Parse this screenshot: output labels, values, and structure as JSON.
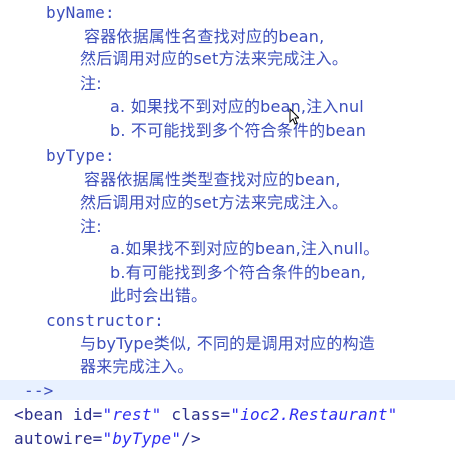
{
  "doc": {
    "byName": {
      "heading": "byName:",
      "desc1": "容器依据属性名查找对应的bean,",
      "desc2": "然后调用对应的set方法来完成注入。",
      "note": "注:",
      "a": "a. 如果找不到对应的bean,注入nul",
      "b": "b. 不可能找到多个符合条件的bean"
    },
    "byType": {
      "heading": "byType:",
      "desc1": "容器依据属性类型查找对应的bean,",
      "desc2": "然后调用对应的set方法来完成注入。",
      "note": "注:",
      "a": "a.如果找不到对应的bean,注入null。",
      "b1": "b.有可能找到多个符合条件的bean,",
      "b2": "此时会出错。"
    },
    "constructor": {
      "heading": "constructor:",
      "desc1": "与byType类似, 不同的是调用对应的构造",
      "desc2": "器来完成注入。"
    }
  },
  "code": {
    "comment_end": "-->",
    "bean_open": "<bean",
    "attr_id": "id=",
    "val_id": "\"rest\"",
    "attr_class": "class=",
    "val_class": "\"ioc2.Restaurant\"",
    "attr_autowire": "autowire=",
    "val_autowire": "\"byType\"",
    "close": "/>"
  },
  "colors": {
    "text": "#3b4dbb",
    "value": "#2d2df0",
    "highlight": "#e8f1ff"
  },
  "icons": [
    "mouse-cursor-icon"
  ]
}
